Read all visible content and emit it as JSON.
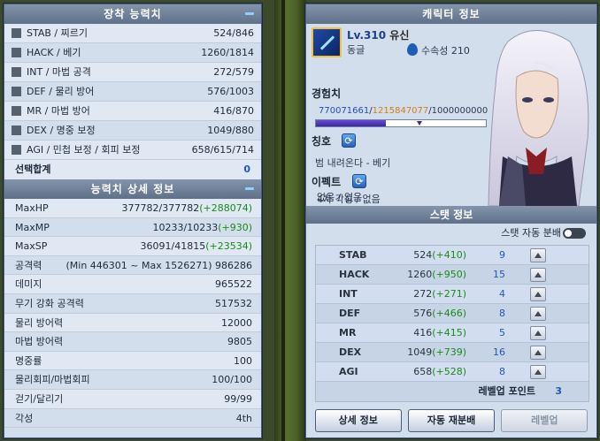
{
  "equip_panel": {
    "title": "장착 능력치",
    "rows": [
      {
        "name": "STAB / 찌르기",
        "value": "524/846"
      },
      {
        "name": "HACK / 베기",
        "value": "1260/1814"
      },
      {
        "name": "INT / 마법 공격",
        "value": "272/579"
      },
      {
        "name": "DEF / 물리 방어",
        "value": "576/1003"
      },
      {
        "name": "MR / 마법 방어",
        "value": "416/870"
      },
      {
        "name": "DEX / 명중 보정",
        "value": "1049/880"
      },
      {
        "name": "AGI / 민첩 보정 / 회피 보정",
        "value": "658/615/714"
      }
    ],
    "sum_label": "선택합계",
    "sum_value": "0"
  },
  "detail_panel": {
    "title": "능력치 상세 정보",
    "rows": [
      {
        "name": "MaxHP",
        "value": "377782/377782",
        "plus": "(+288074)"
      },
      {
        "name": "MaxMP",
        "value": "10233/10233",
        "plus": "(+930)"
      },
      {
        "name": "MaxSP",
        "value": "36091/41815",
        "plus": "(+23534)"
      },
      {
        "name": "공격력",
        "value": "(Min 446301 ~ Max 1526271) 986286",
        "plus": ""
      },
      {
        "name": "데미지",
        "value": "965522",
        "plus": ""
      },
      {
        "name": "무기 강화 공격력",
        "value": "517532",
        "plus": ""
      },
      {
        "name": "물리 방어력",
        "value": "12000",
        "plus": ""
      },
      {
        "name": "마법 방어력",
        "value": "9805",
        "plus": ""
      },
      {
        "name": "명중률",
        "value": "100",
        "plus": ""
      },
      {
        "name": "물리회피/마법회피",
        "value": "100/100",
        "plus": ""
      },
      {
        "name": "걷기/달리기",
        "value": "99/99",
        "plus": ""
      },
      {
        "name": "각성",
        "value": "4th",
        "plus": ""
      }
    ]
  },
  "char_panel": {
    "title": "캐릭터 정보",
    "level": "Lv.310",
    "name": "유신",
    "guild": "동글",
    "element": "수속성 210",
    "exp_label": "경험치",
    "exp_current": "770071661",
    "exp_required": "1215847077",
    "exp_max": "1000000000",
    "exp_fill_fraction": 0.41,
    "exp_mark_fraction": 0.61,
    "title_label": "칭호",
    "title_value": "범 내려온다 - 베기",
    "effect_label": "이펙트",
    "effect_line1": "4차 각성 / 없음",
    "effect_line2": "없음 / 없음"
  },
  "stat_panel": {
    "title": "스탯 정보",
    "auto_label": "스탯 자동 분배",
    "auto_on": false,
    "rows": [
      {
        "name": "STAB",
        "base": "524",
        "plus": "(+410)",
        "points": "9"
      },
      {
        "name": "HACK",
        "base": "1260",
        "plus": "(+950)",
        "points": "15"
      },
      {
        "name": "INT",
        "base": "272",
        "plus": "(+271)",
        "points": "4"
      },
      {
        "name": "DEF",
        "base": "576",
        "plus": "(+466)",
        "points": "8"
      },
      {
        "name": "MR",
        "base": "416",
        "plus": "(+415)",
        "points": "5"
      },
      {
        "name": "DEX",
        "base": "1049",
        "plus": "(+739)",
        "points": "16"
      },
      {
        "name": "AGI",
        "base": "658",
        "plus": "(+528)",
        "points": "8"
      }
    ],
    "levelup_points_label": "레벨업 포인트",
    "levelup_points": "3"
  },
  "buttons": {
    "detail": "상세 정보",
    "auto": "자동 재분배",
    "levelup": "레벨업"
  },
  "colors": {
    "accent_blue": "#2456b8",
    "plus_green": "#1a8a1a",
    "exp_required": "#d08010"
  }
}
